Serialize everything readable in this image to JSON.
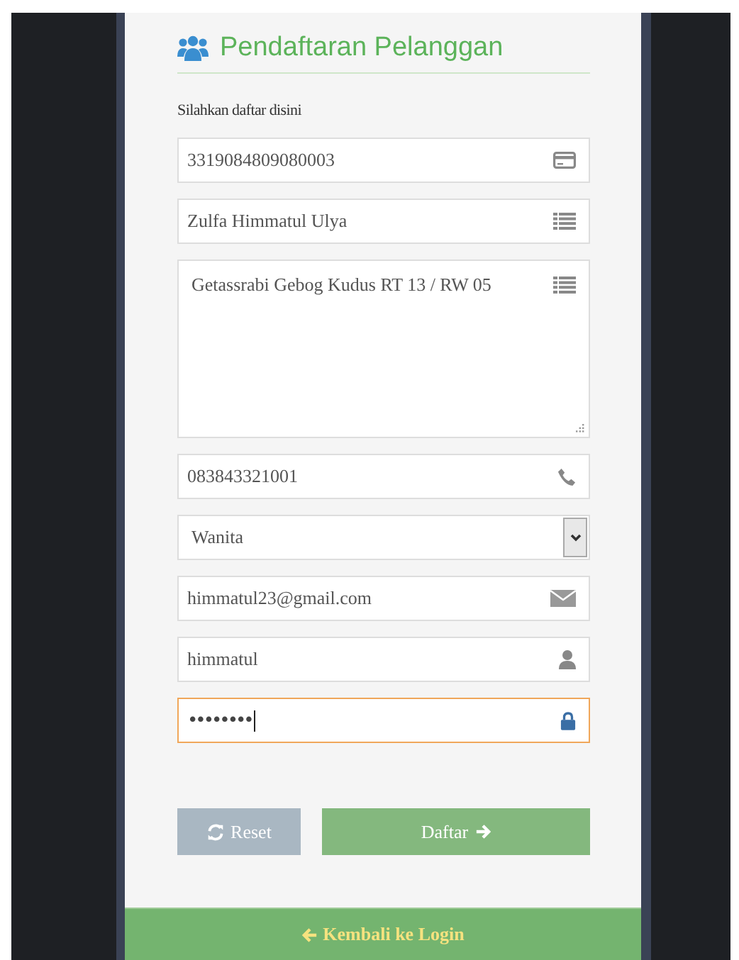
{
  "title": "Pendaftaran Pelanggan",
  "subtitle": "Silahkan daftar disini",
  "fields": [
    {
      "kind": "card",
      "value": "3319084809080003",
      "focused": false
    },
    {
      "kind": "list",
      "value": "Zulfa Himmatul Ulya",
      "focused": false
    },
    {
      "kind": "textarea",
      "value": "Getassrabi Gebog Kudus RT 13 / RW 05",
      "focused": false
    },
    {
      "kind": "phone",
      "value": "083843321001",
      "focused": false
    },
    {
      "kind": "select",
      "value": "Wanita",
      "focused": false
    },
    {
      "kind": "email",
      "value": "himmatul23@gmail.com",
      "focused": false
    },
    {
      "kind": "user",
      "value": "himmatul",
      "focused": false
    },
    {
      "kind": "password",
      "value": "••••••••",
      "focused": true
    }
  ],
  "buttons": [
    {
      "kind": "reset",
      "label": "Reset"
    },
    {
      "kind": "submit",
      "label": "Daftar"
    }
  ],
  "footer_link": "Kembali ke Login"
}
